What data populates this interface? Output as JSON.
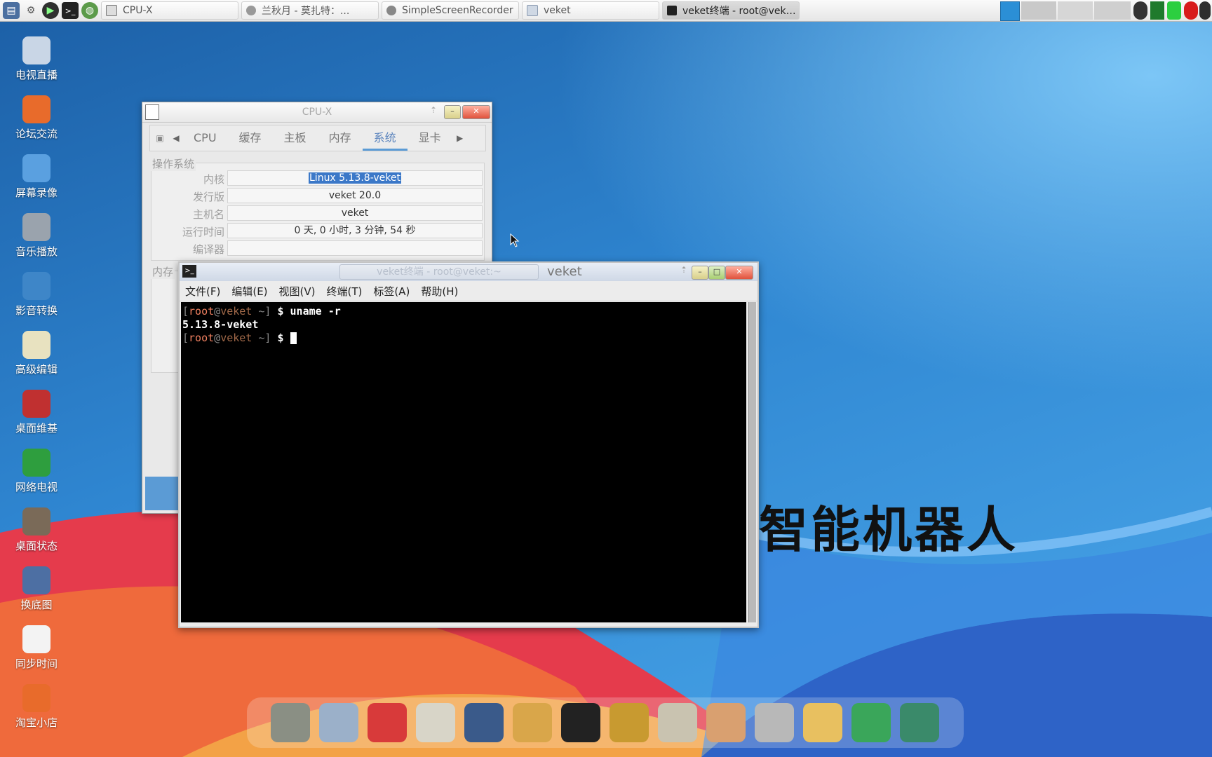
{
  "taskbar": {
    "launchers": [
      "screenshot-icon",
      "tools-icon",
      "play-icon",
      "terminal-icon",
      "globe-icon"
    ],
    "tasks": [
      {
        "label": "CPU-X",
        "icon": "cpux-icon",
        "active": false
      },
      {
        "label": "兰秋月 - 莫扎特：...",
        "icon": "music-icon",
        "active": false
      },
      {
        "label": "SimpleScreenRecorder",
        "icon": "recorder-icon",
        "active": false
      },
      {
        "label": "veket",
        "icon": "folder-icon",
        "active": false
      },
      {
        "label": "veket终端 - root@vek…",
        "icon": "terminal-icon",
        "active": true
      }
    ]
  },
  "desktop_icons": [
    {
      "label": "电视直播",
      "icon": "tv-icon",
      "color": "#c9d6e6"
    },
    {
      "label": "论坛交流",
      "icon": "firefox-icon",
      "color": "#e86b2b"
    },
    {
      "label": "屏幕录像",
      "icon": "recorder-icon",
      "color": "#5aa0e0"
    },
    {
      "label": "音乐播放",
      "icon": "speaker-icon",
      "color": "#9aa3ad"
    },
    {
      "label": "影音转换",
      "icon": "media-convert-icon",
      "color": "#3e86c8"
    },
    {
      "label": "高级编辑",
      "icon": "editor-icon",
      "color": "#e8e2c0"
    },
    {
      "label": "桌面维基",
      "icon": "wiki-icon",
      "color": "#c03030"
    },
    {
      "label": "网络电视",
      "icon": "play-icon",
      "color": "#2e9e3e"
    },
    {
      "label": "桌面状态",
      "icon": "status-icon",
      "color": "#7a6a58"
    },
    {
      "label": "换底图",
      "icon": "monitor-icon",
      "color": "#4d6fa3"
    },
    {
      "label": "同步时间",
      "icon": "calendar-icon",
      "color": "#f3f3f3"
    },
    {
      "label": "淘宝小店",
      "icon": "firefox-icon",
      "color": "#e86b2b"
    }
  ],
  "wallpaper_text": "智能机器人",
  "cpux": {
    "title": "CPU-X",
    "tabs": [
      "CPU",
      "缓存",
      "主板",
      "内存",
      "系统",
      "显卡"
    ],
    "active_tab": "系统",
    "os_section": "操作系统",
    "rows": [
      {
        "key": "内核",
        "value": "Linux 5.13.8-veket",
        "selected": true
      },
      {
        "key": "发行版",
        "value": "veket 20.0"
      },
      {
        "key": "主机名",
        "value": "veket"
      },
      {
        "key": "运行时间",
        "value": "0 天, 0 小时, 3 分钟, 54 秒"
      },
      {
        "key": "编译器",
        "value": ""
      }
    ],
    "mem_section": "内存"
  },
  "terminal": {
    "title_faded": "veket终端 - root@veket:~",
    "title": "veket",
    "menu": [
      "文件(F)",
      "编辑(E)",
      "视图(V)",
      "终端(T)",
      "标签(A)",
      "帮助(H)"
    ],
    "prompt": {
      "open": "[",
      "user": "root",
      "at": "@",
      "host": "veket",
      "path": " ~]",
      "sign": " $ "
    },
    "command": "uname -r",
    "output": "5.13.8-veket"
  },
  "dock": [
    "files-icon",
    "monitor-icon",
    "pet-icon",
    "notes-icon",
    "music-player-icon",
    "users-icon",
    "qq-icon",
    "contacts-icon",
    "chart-icon",
    "paint-icon",
    "usb-icon",
    "mascot-icon",
    "help-icon",
    "camera-icon"
  ]
}
